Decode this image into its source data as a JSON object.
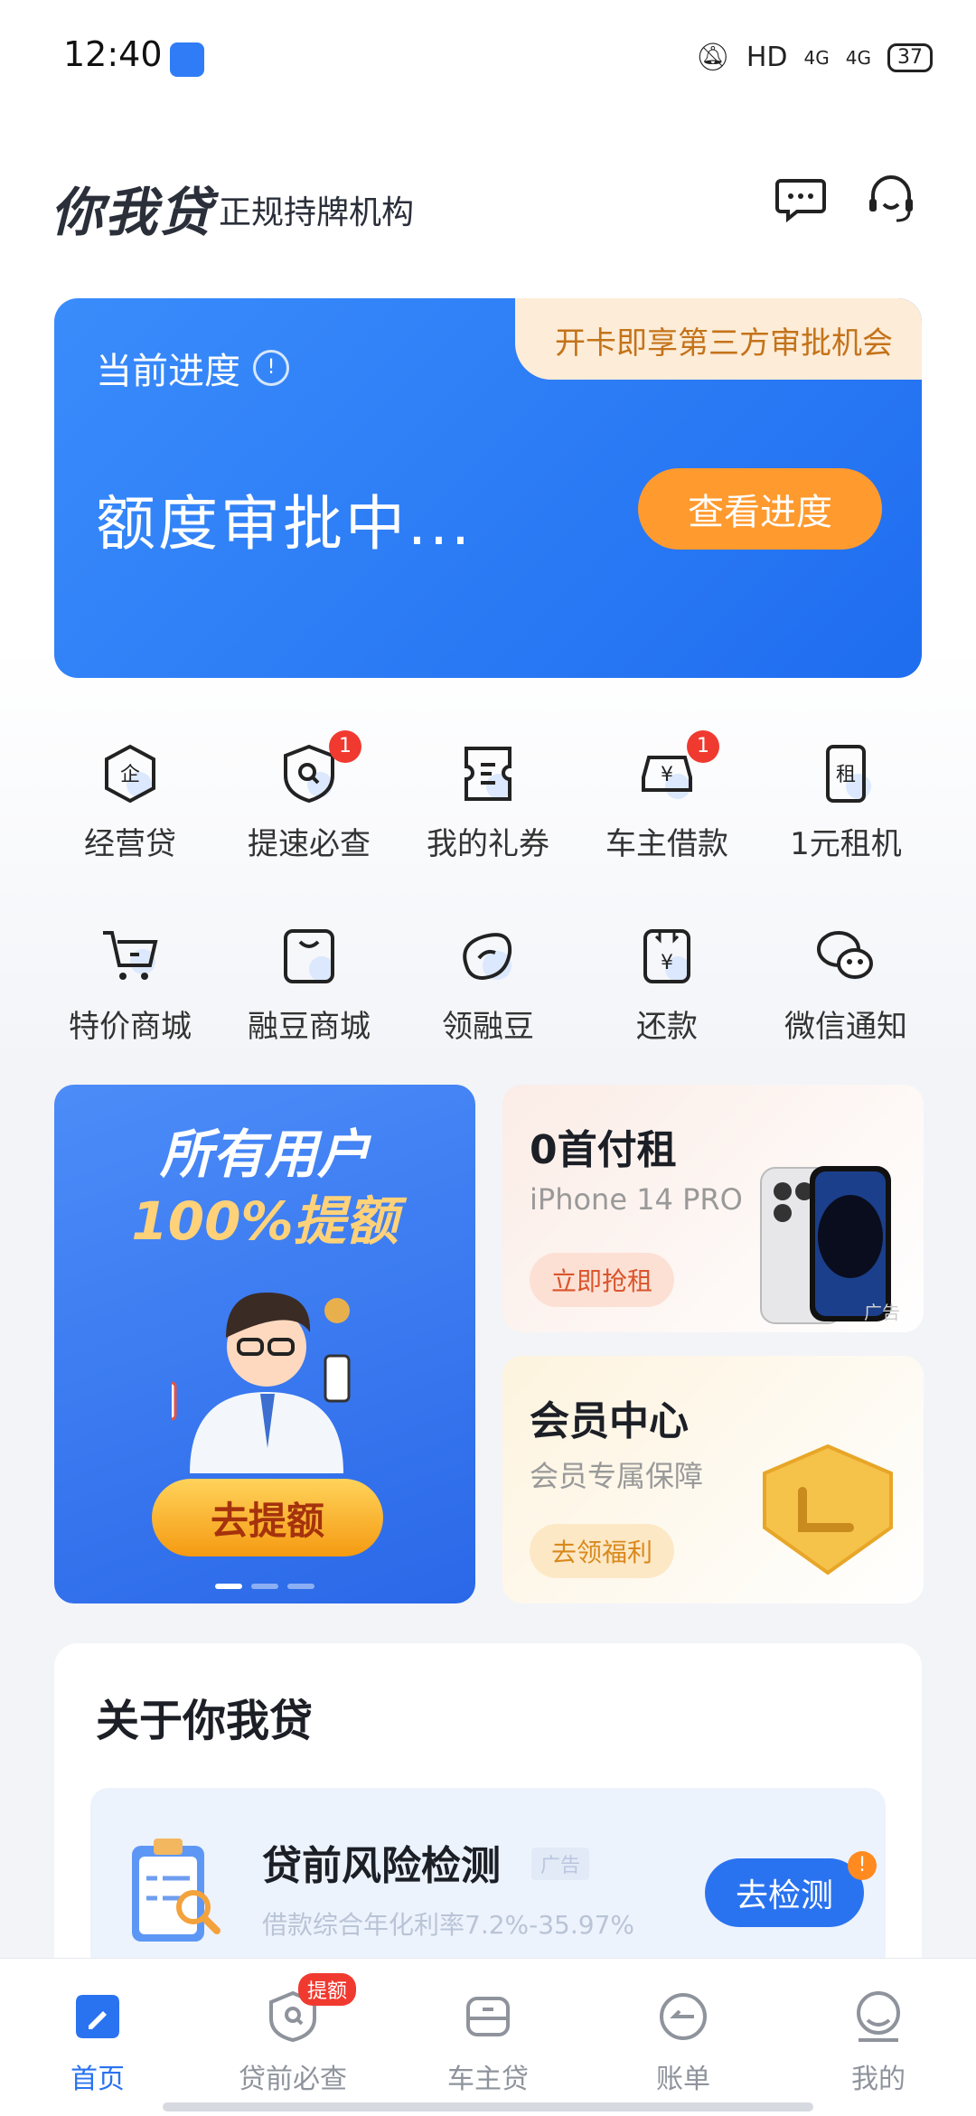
{
  "status_bar": {
    "time": "12:40",
    "indicators": "HD",
    "network1": "4G",
    "network2": "4G",
    "battery": "37"
  },
  "header": {
    "logo": "你我贷",
    "subtitle": "正规持牌机构"
  },
  "progress_card": {
    "label": "当前进度",
    "promo": "开卡即享第三方审批机会",
    "status": "额度审批中...",
    "button": "查看进度"
  },
  "grid": [
    {
      "label": "经营贷",
      "icon": "enterprise-shield-icon",
      "badge": ""
    },
    {
      "label": "提速必查",
      "icon": "search-shield-icon",
      "badge": "1"
    },
    {
      "label": "我的礼券",
      "icon": "coupon-icon",
      "badge": ""
    },
    {
      "label": "车主借款",
      "icon": "car-yen-icon",
      "badge": "1"
    },
    {
      "label": "1元租机",
      "icon": "rent-phone-icon",
      "badge": ""
    },
    {
      "label": "特价商城",
      "icon": "cart-icon",
      "badge": ""
    },
    {
      "label": "融豆商城",
      "icon": "bag-icon",
      "badge": ""
    },
    {
      "label": "领融豆",
      "icon": "bean-icon",
      "badge": ""
    },
    {
      "label": "还款",
      "icon": "repay-icon",
      "badge": ""
    },
    {
      "label": "微信通知",
      "icon": "wechat-icon",
      "badge": ""
    }
  ],
  "grid_glyphs": {
    "enterprise": "企",
    "rent": "租",
    "yen": "¥"
  },
  "banner_left": {
    "line1": "所有用户",
    "line2": "100%提额",
    "button": "去提额"
  },
  "card_rent": {
    "title": "0首付租",
    "subtitle": "iPhone 14 PRO",
    "button": "立即抢租",
    "ad": "广告"
  },
  "card_member": {
    "title": "会员中心",
    "subtitle": "会员专属保障",
    "button": "去领福利"
  },
  "about": {
    "title": "关于你我贷",
    "risk_title": "贷前风险检测",
    "risk_ad": "广告",
    "risk_sub": "借款综合年化利率7.2%-35.97%",
    "risk_button": "去检测",
    "risk_alert": "!"
  },
  "nav": [
    {
      "label": "首页",
      "icon": "home-icon",
      "active": true,
      "badge": ""
    },
    {
      "label": "贷前必查",
      "icon": "check-shield-icon",
      "active": false,
      "badge": "提额"
    },
    {
      "label": "车主贷",
      "icon": "car-icon",
      "active": false,
      "badge": ""
    },
    {
      "label": "账单",
      "icon": "bill-icon",
      "active": false,
      "badge": ""
    },
    {
      "label": "我的",
      "icon": "profile-icon",
      "active": false,
      "badge": ""
    }
  ],
  "colors": {
    "primary": "#2a73f0",
    "orange": "#ff9a2e",
    "badge_red": "#f03a30",
    "nav_inactive": "#8e939c"
  }
}
